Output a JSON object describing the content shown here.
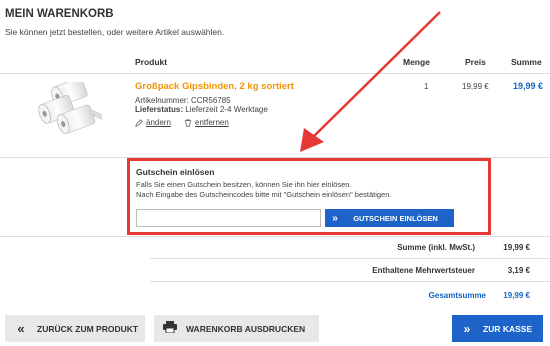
{
  "header": {
    "title": "MEIN WARENKORB",
    "subtitle": "Sie können jetzt bestellen, oder weitere Artikel auswählen."
  },
  "table": {
    "headers": {
      "product": "Produkt",
      "qty": "Menge",
      "price": "Preis",
      "sum": "Summe"
    }
  },
  "item": {
    "name": "Großpack Gipsbinden, 2 kg sortiert",
    "article_label": "Artikelnummer:",
    "article_number": "CCR56785",
    "status_label": "Lieferstatus:",
    "status_value": "Lieferzeit 2-4 Werktage",
    "edit_label": "ändern",
    "remove_label": "entfernen",
    "qty": "1",
    "price": "19,99 €",
    "sum": "19,99 €"
  },
  "coupon": {
    "heading": "Gutschein einlösen",
    "line1": "Falls Sie einen Gutschein besitzen, können Sie ihn hier einlösen.",
    "line2": "Nach Eingabe des Gutscheincodes bitte mit \"Gutschein einlösen\" bestätigen.",
    "input_value": "",
    "button_label": "GUTSCHEIN EINLÖSEN"
  },
  "totals": {
    "sum_label": "Summe (inkl. MwSt.)",
    "sum_value": "19,99 €",
    "vat_label": "Enthaltene Mehrwertsteuer",
    "vat_value": "3,19 €",
    "total_label": "Gesamtsumme",
    "total_value": "19,99 €"
  },
  "footer": {
    "back_label": "ZURÜCK ZUM PRODUKT",
    "print_label": "WARENKORB AUSDRUCKEN",
    "checkout_label": "ZUR KASSE"
  },
  "icons": {
    "back": "double-chevron-left-icon",
    "print": "printer-icon",
    "checkout": "double-chevron-right-icon",
    "coupon": "double-chevron-right-icon",
    "edit": "pencil-icon",
    "remove": "trash-icon"
  },
  "colors": {
    "accent_blue": "#1e63c7",
    "product_orange": "#f29400",
    "highlight_red": "#e53935",
    "button_gray": "#e8e8e8"
  }
}
